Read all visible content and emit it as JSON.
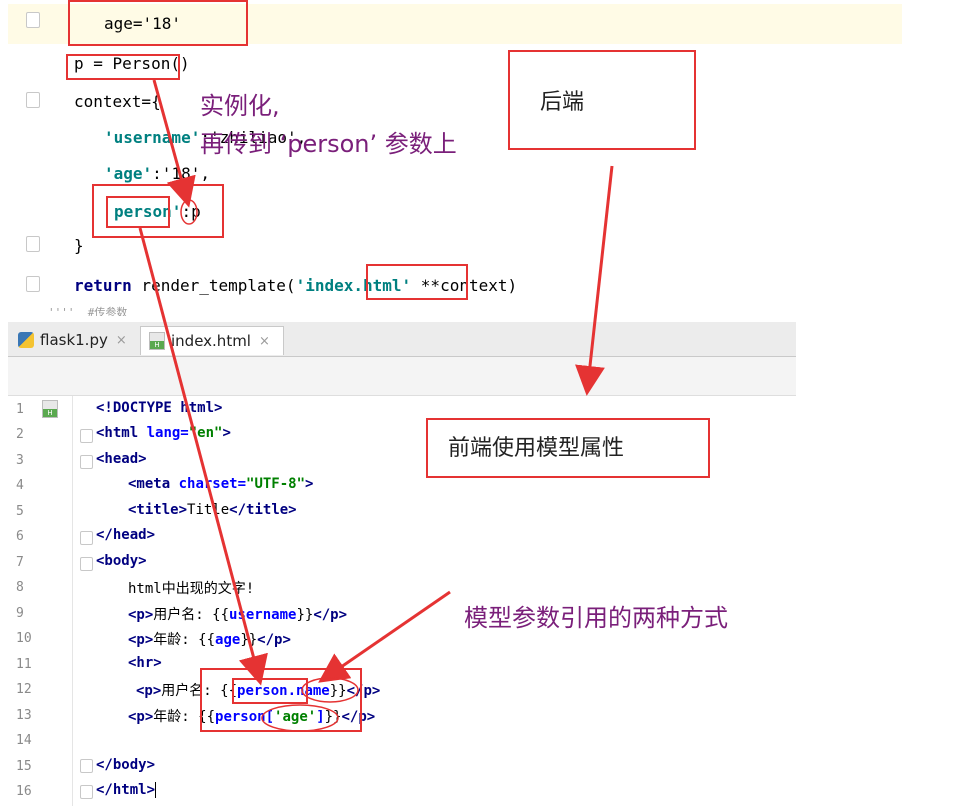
{
  "python_code": {
    "line_age": "age='18'",
    "line_p": "p = Person()",
    "line_context_open": "context={",
    "line_username_key": "'username'",
    "line_username_rest": ":'zhiliao',",
    "line_age_key": "'age'",
    "line_age_rest": ":'18',",
    "line_person_key": "person'",
    "line_person_rest": ":p",
    "line_context_close": "}",
    "line_return_kw": "return",
    "line_return_rest": " render_template(",
    "line_return_str": "'index.html'",
    "line_return_ctx": "**context)",
    "line_cut": "''''  #传参数"
  },
  "tabs": [
    {
      "label": "flask1.py",
      "icon": "python-file-icon",
      "close": "×"
    },
    {
      "label": "index.html",
      "icon": "html-file-icon",
      "close": "×"
    }
  ],
  "html_code": {
    "line_numbers": [
      "1",
      "2",
      "3",
      "4",
      "5",
      "6",
      "7",
      "8",
      "9",
      "10",
      "11",
      "12",
      "13",
      "14",
      "15",
      "16"
    ],
    "l1": "<!DOCTYPE html>",
    "l2_tag": "<html",
    "l2_attr": " lang=",
    "l2_val": "\"en\"",
    "l2_end": ">",
    "l3": "<head>",
    "l4_tag": "<meta",
    "l4_attr": " charset=",
    "l4_val": "\"UTF-8\"",
    "l4_end": ">",
    "l5_open": "<title>",
    "l5_text": "Title",
    "l5_close": "</title>",
    "l6": "</head>",
    "l7": "<body>",
    "l8": "html中出现的文字!",
    "l9_open": "<p>",
    "l9_text": "用户名: {{",
    "l9_var": "username",
    "l9_end": "}}",
    "l9_close": "</p>",
    "l10_open": "<p>",
    "l10_text": "年龄: {{",
    "l10_var": "age",
    "l10_end": "}}",
    "l10_close": "</p>",
    "l11": "<hr>",
    "l12_open": "<p>",
    "l12_text": "用户名: {{",
    "l12_var": "person.name",
    "l12_end": "}}",
    "l12_close": "</p>",
    "l13_open": "<p>",
    "l13_text": "年龄: {{",
    "l13_var": "person[",
    "l13_str": "'age'",
    "l13_var2": "]",
    "l13_end": "}}",
    "l13_close": "</p>",
    "l14": "",
    "l15": "</body>",
    "l16": "</html>"
  },
  "annotations": {
    "instantiate": "实例化,",
    "pass_to_param": "再传到 ‘person’ 参数上",
    "backend": "后端",
    "frontend_use": "前端使用模型属性",
    "two_ways": "模型参数引用的两种方式"
  },
  "colors": {
    "annotation_red": "#e53333",
    "annotation_text": "#7a1f7a",
    "keyword": "#000080",
    "string": "#008080",
    "html_value": "#008000"
  }
}
